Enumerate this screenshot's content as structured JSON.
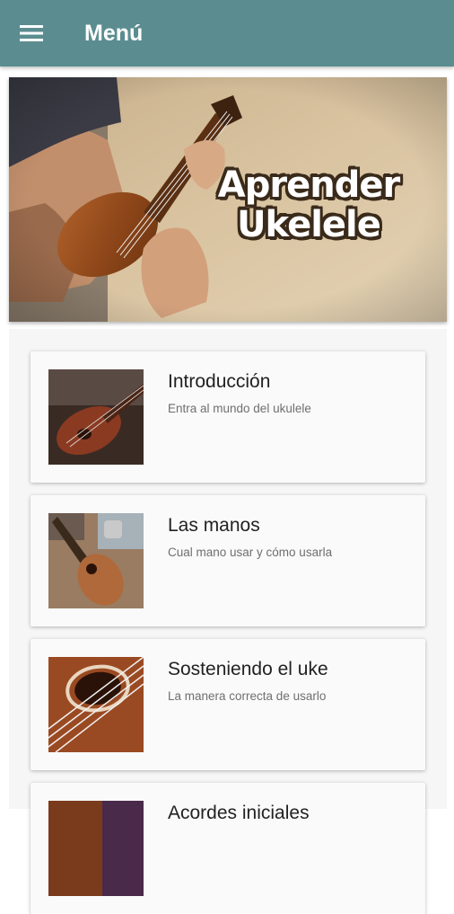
{
  "app_bar": {
    "title": "Menú",
    "menu_icon": "hamburger-menu-icon",
    "color": "#5b8d90"
  },
  "banner": {
    "line1": "Aprender",
    "line2": "Ukelele"
  },
  "lessons": [
    {
      "title": "Introducción",
      "subtitle": "Entra al mundo del ukulele"
    },
    {
      "title": "Las manos",
      "subtitle": "Cual mano usar y cómo usarla"
    },
    {
      "title": "Sosteniendo el uke",
      "subtitle": "La manera correcta de usarlo"
    },
    {
      "title": "Acordes iniciales",
      "subtitle": ""
    }
  ]
}
